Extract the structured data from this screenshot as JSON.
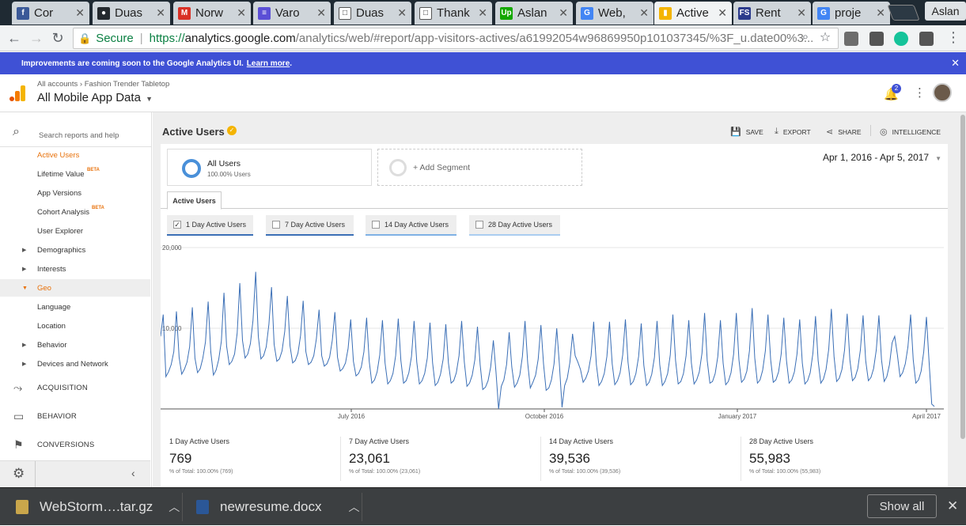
{
  "browser": {
    "tabs": [
      {
        "label": "Cor",
        "color": "#3b5998",
        "glyph": "f"
      },
      {
        "label": "Duas",
        "color": "#24292e",
        "glyph": "●"
      },
      {
        "label": "Norw",
        "color": "#d93025",
        "glyph": "M"
      },
      {
        "label": "Varo",
        "color": "#5b4fd6",
        "glyph": "≡"
      },
      {
        "label": "Duas",
        "color": "#ffffff",
        "glyph": "□"
      },
      {
        "label": "Thank",
        "color": "#ffffff",
        "glyph": "□"
      },
      {
        "label": "Aslan",
        "color": "#14a800",
        "glyph": "Up"
      },
      {
        "label": "Web,",
        "color": "#4285f4",
        "glyph": "G"
      },
      {
        "label": "Active",
        "color": "#f4b400",
        "glyph": "▮"
      },
      {
        "label": "Rent",
        "color": "#2b3a8c",
        "glyph": "FS"
      },
      {
        "label": "proje",
        "color": "#4285f4",
        "glyph": "G"
      }
    ],
    "profile_name": "Aslan",
    "secure_label": "Secure",
    "url_prefix": "https://",
    "url_host": "analytics.google.com",
    "url_rest": "/analytics/web/#report/app-visitors-actives/a61992054w96869950p101037345/%3F_u.date00%3..."
  },
  "banner": {
    "text": "Improvements are coming soon to the Google Analytics UI.",
    "link": "Learn more",
    "end": "."
  },
  "header": {
    "breadcrumb_root": "All accounts",
    "breadcrumb_sep": "›",
    "breadcrumb_account": "Fashion Trender Tabletop",
    "view_title": "All Mobile App Data",
    "notification_count": "2"
  },
  "sidebar": {
    "search_placeholder": "Search reports and help",
    "items": [
      {
        "label": "Active Users"
      },
      {
        "label": "Lifetime Value",
        "badge": "BETA"
      },
      {
        "label": "App Versions"
      },
      {
        "label": "Cohort Analysis",
        "badge": "BETA"
      },
      {
        "label": "User Explorer"
      },
      {
        "label": "Demographics"
      },
      {
        "label": "Interests"
      },
      {
        "label": "Geo"
      },
      {
        "label": "Language"
      },
      {
        "label": "Location"
      },
      {
        "label": "Behavior"
      },
      {
        "label": "Devices and Network"
      }
    ],
    "sections": [
      {
        "label": "ACQUISITION"
      },
      {
        "label": "BEHAVIOR"
      },
      {
        "label": "CONVERSIONS"
      }
    ]
  },
  "report": {
    "title": "Active Users",
    "actions": {
      "save": "SAVE",
      "export": "EXPORT",
      "share": "SHARE",
      "intelligence": "INTELLIGENCE"
    },
    "segment_name": "All Users",
    "segment_pct": "100.00% Users",
    "add_segment": "+ Add Segment",
    "date_range": "Apr 1, 2016 - Apr 5, 2017",
    "tab_label": "Active Users",
    "metric_buttons": [
      {
        "label": "1 Day Active Users",
        "checked": true,
        "color": "#3b6fb6"
      },
      {
        "label": "7 Day Active Users",
        "checked": false,
        "color": "#3b6fb6"
      },
      {
        "label": "14 Day Active Users",
        "checked": false,
        "color": "#7fb1e5"
      },
      {
        "label": "28 Day Active Users",
        "checked": false,
        "color": "#aacdf0"
      }
    ],
    "stats": [
      {
        "label": "1 Day Active Users",
        "value": "769",
        "total": "% of Total: 100.00% (769)"
      },
      {
        "label": "7 Day Active Users",
        "value": "23,061",
        "total": "% of Total: 100.00% (23,061)"
      },
      {
        "label": "14 Day Active Users",
        "value": "39,536",
        "total": "% of Total: 100.00% (39,536)"
      },
      {
        "label": "28 Day Active Users",
        "value": "55,983",
        "total": "% of Total: 100.00% (55,983)"
      }
    ]
  },
  "downloads": {
    "items": [
      {
        "label": "WebStorm….tar.gz"
      },
      {
        "label": "newresume.docx"
      }
    ],
    "show_all": "Show all"
  },
  "chart_data": {
    "type": "line",
    "title": "",
    "xlabel": "",
    "ylabel": "",
    "ylim": [
      0,
      20000
    ],
    "y_ticks": [
      "20,000",
      "10,000"
    ],
    "x_ticks": [
      "July 2016",
      "October 2016",
      "January 2017",
      "April 2017"
    ],
    "color": "#3b6fb6",
    "series": [
      {
        "values": [
          9000,
          11700,
          4000,
          4600,
          5500,
          7100,
          12100,
          6400,
          4300,
          4900,
          5800,
          7700,
          12600,
          6300,
          4500,
          5000,
          6300,
          8300,
          13300,
          7100,
          4200,
          4800,
          6100,
          8400,
          14400,
          7800,
          5500,
          5900,
          6800,
          9400,
          15600,
          8500,
          6300,
          6800,
          8100,
          11000,
          17000,
          9000,
          6200,
          6600,
          7700,
          10500,
          15100,
          8000,
          5900,
          6200,
          7200,
          9600,
          14000,
          7800,
          5700,
          6000,
          6900,
          9100,
          13400,
          7100,
          5500,
          5800,
          6600,
          8700,
          12300,
          6600,
          5300,
          5600,
          6400,
          8500,
          12000,
          6400,
          4700,
          5000,
          5700,
          7500,
          11100,
          5900,
          4100,
          4400,
          5200,
          7100,
          11300,
          5900,
          3200,
          3600,
          4600,
          6700,
          11000,
          5700,
          3100,
          3500,
          4400,
          6600,
          11200,
          6000,
          3200,
          3500,
          4500,
          6500,
          10900,
          5800,
          3100,
          3500,
          4400,
          6300,
          10700,
          5700,
          2900,
          3300,
          4300,
          6200,
          10500,
          5700,
          3200,
          3500,
          4500,
          6600,
          10900,
          5800,
          2800,
          3200,
          4200,
          6100,
          10200,
          5500,
          2400,
          2700,
          3500,
          5200,
          8500,
          4600,
          0,
          2800,
          3600,
          5500,
          9500,
          5200,
          2700,
          3200,
          4200,
          6500,
          10900,
          5700,
          2600,
          3300,
          4200,
          6200,
          10400,
          5600,
          2300,
          2600,
          3600,
          5600,
          10000,
          5600,
          200,
          2900,
          3800,
          5800,
          9300,
          6600,
          5800,
          4900,
          3300,
          3800,
          4700,
          6600,
          10800,
          5500,
          2900,
          3400,
          4400,
          6500,
          10800,
          5600,
          3000,
          3500,
          4500,
          6700,
          11100,
          5800,
          3000,
          3400,
          4400,
          6500,
          10600,
          5400,
          2900,
          3300,
          4300,
          6400,
          10900,
          5500,
          2900,
          3400,
          4400,
          6700,
          11700,
          6000,
          3100,
          3400,
          4400,
          6600,
          11000,
          5700,
          3100,
          3600,
          4600,
          6900,
          11900,
          6000,
          3200,
          3400,
          4400,
          6500,
          11000,
          5700,
          3000,
          3400,
          4500,
          6800,
          11900,
          6100,
          3300,
          3700,
          4700,
          7200,
          12500,
          6300,
          3200,
          3600,
          4800,
          7200,
          11700,
          6100,
          3300,
          3600,
          4600,
          6800,
          11300,
          6000,
          3200,
          3600,
          4600,
          6800,
          11100,
          5700,
          3100,
          3500,
          4500,
          6900,
          11500,
          6000,
          3200,
          3700,
          4900,
          7400,
          12400,
          6500,
          3400,
          3800,
          4900,
          7300,
          11800,
          6100,
          3500,
          3900,
          5000,
          7300,
          11600,
          6000,
          3500,
          3900,
          5000,
          7300,
          11600,
          6100,
          3400,
          4000,
          5500,
          8200,
          9000,
          6700,
          4000,
          4500,
          5600,
          7700,
          11700,
          6100,
          3200,
          3600,
          4700,
          7100,
          11400,
          5900,
          600,
          300
        ]
      }
    ]
  }
}
